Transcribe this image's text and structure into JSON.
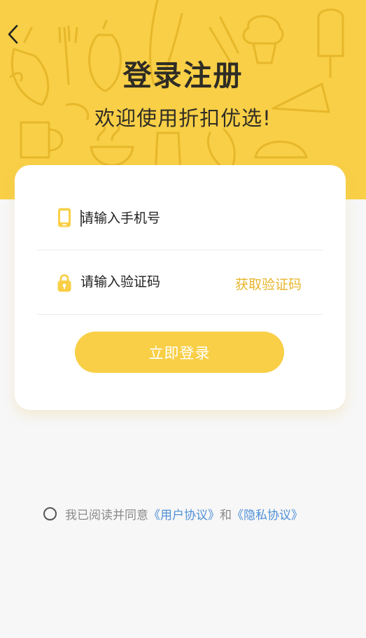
{
  "header": {
    "back_icon": "chevron-left-icon",
    "title": "登录注册",
    "subtitle": "欢迎使用折扣优选!"
  },
  "form": {
    "phone": {
      "icon": "phone-icon",
      "value": "",
      "placeholder": "请输入手机号"
    },
    "code": {
      "icon": "lock-icon",
      "value": "",
      "placeholder": "请输入验证码",
      "action_label": "获取验证码"
    },
    "submit_label": "立即登录"
  },
  "agreement": {
    "checked": false,
    "prefix": "我已阅读并同意",
    "user_link": "《用户协议》",
    "and": "和",
    "privacy_link": "《隐私协议》"
  },
  "colors": {
    "accent": "#f8cf46",
    "accent_text": "#e7b52b",
    "link": "#4e8fd6",
    "background": "#f7f7f7"
  }
}
